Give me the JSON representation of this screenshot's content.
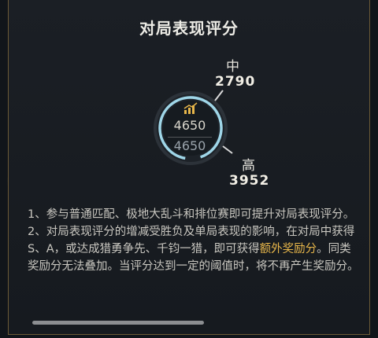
{
  "panel": {
    "title": "对局表现评分"
  },
  "gauge": {
    "mid_label": "中",
    "mid_value": "2790",
    "high_label": "高",
    "high_value": "3952",
    "current_score": "4650",
    "score_reflection": "4650",
    "rank_icon": "rank-chart-icon",
    "ring_color": "#9fd6e8",
    "accent_color": "#e7b64a"
  },
  "description": {
    "line1": "1、参与普通匹配、极地大乱斗和排位赛即可提升对局表现评分。",
    "line2_prefix": "2、对局表现评分的增减受胜负及单局表现的影响，在对局中获得S、A，或达成猎勇争先、千钧一猎，即可获得",
    "line2_highlight": "额外奖励分",
    "line2_suffix": "。同类奖励分无法叠加。当评分达到一定的阈值时，将不再产生奖励分。"
  }
}
